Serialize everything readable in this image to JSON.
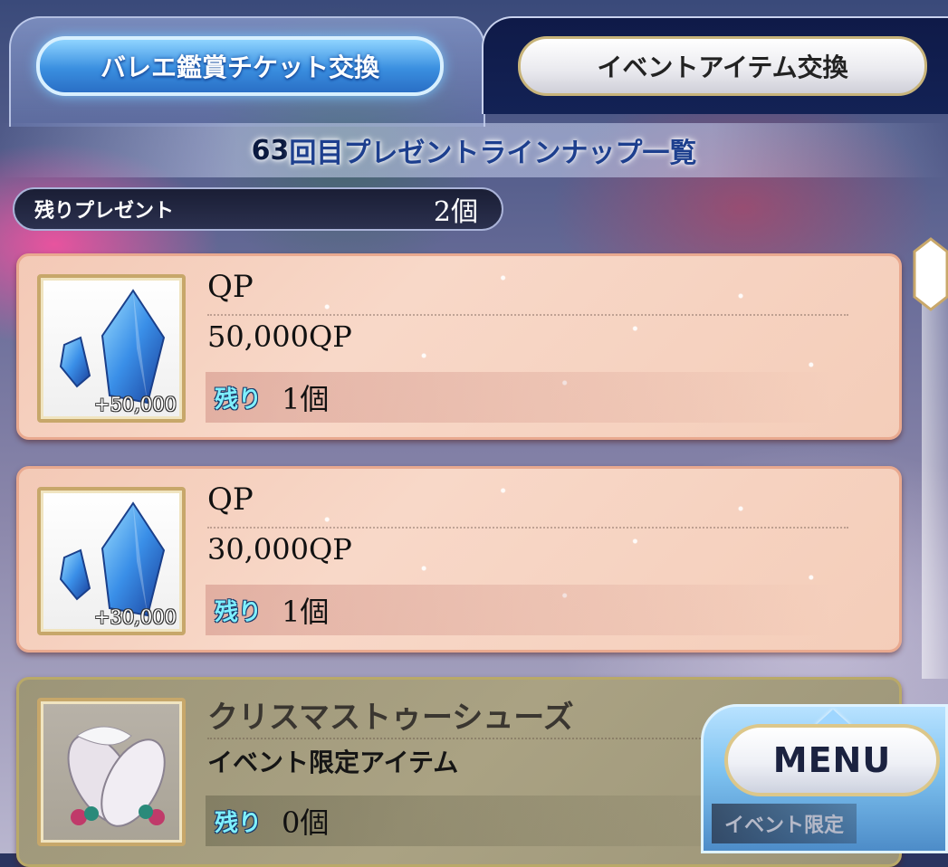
{
  "tabs": [
    {
      "label": "バレエ鑑賞チケット交換",
      "active": true
    },
    {
      "label": "イベントアイテム交換",
      "active": false
    }
  ],
  "lineup": {
    "number": "63",
    "title_suffix": "回目プレゼントラインナップ一覧"
  },
  "remaining": {
    "label": "残りプレゼント",
    "value": "2個"
  },
  "items": [
    {
      "name": "QP",
      "description": "50,000QP",
      "icon_amount": "+50,000",
      "stock_label": "残り",
      "stock": "1個",
      "icon": "qp-crystal-icon"
    },
    {
      "name": "QP",
      "description": "30,000QP",
      "icon_amount": "+30,000",
      "stock_label": "残り",
      "stock": "1個",
      "icon": "qp-crystal-icon"
    },
    {
      "name": "クリスマストゥーシューズ",
      "description": "イベント限定アイテム",
      "stock_label": "残り",
      "stock": "0個",
      "icon": "ballet-shoes-icon",
      "tag": "イベント限定"
    }
  ],
  "menu": {
    "label": "MENU"
  },
  "colors": {
    "accent_blue": "#3a8fe0",
    "card_peach": "#f4cdb9",
    "stock_cyan": "#7ff0ff"
  }
}
